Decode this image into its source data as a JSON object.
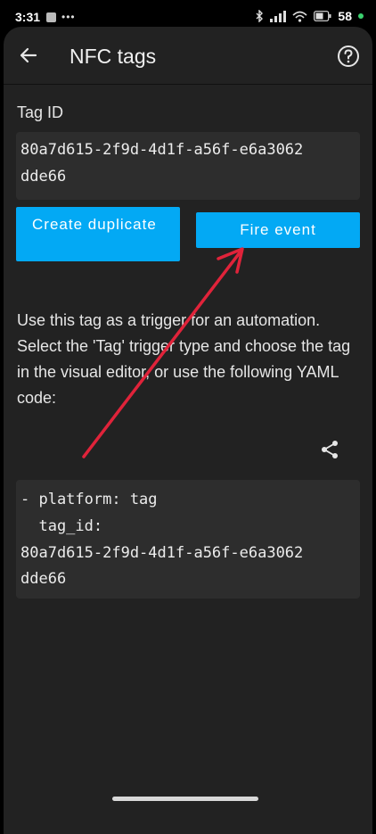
{
  "status_bar": {
    "time": "3:31",
    "battery": "58",
    "icons": [
      "gallery-icon",
      "more-dots-icon",
      "bluetooth-icon",
      "signal-icon",
      "wifi-icon",
      "battery-icon"
    ]
  },
  "appbar": {
    "title": "NFC tags",
    "back_icon": "arrow-left-icon",
    "help_icon": "help-circle-icon"
  },
  "tag": {
    "label": "Tag ID",
    "id_line1": "80a7d615-2f9d-4d1f-a56f-e6a3062",
    "id_line2": "dde66"
  },
  "buttons": {
    "create_duplicate": "Create duplicate",
    "fire_event": "Fire event"
  },
  "description": "Use this tag as a trigger for an automation. Select the 'Tag' trigger type and choose the tag in the visual editor, or use the following YAML code:",
  "share_icon": "share-icon",
  "yaml": {
    "line1": "- platform: tag",
    "line2": "  tag_id:",
    "line3": "80a7d615-2f9d-4d1f-a56f-e6a3062",
    "line4": "dde66"
  },
  "colors": {
    "accent": "#03a9f4",
    "background": "#222222",
    "code_background": "#2d2d2d",
    "annotation_arrow": "#e0233a"
  }
}
